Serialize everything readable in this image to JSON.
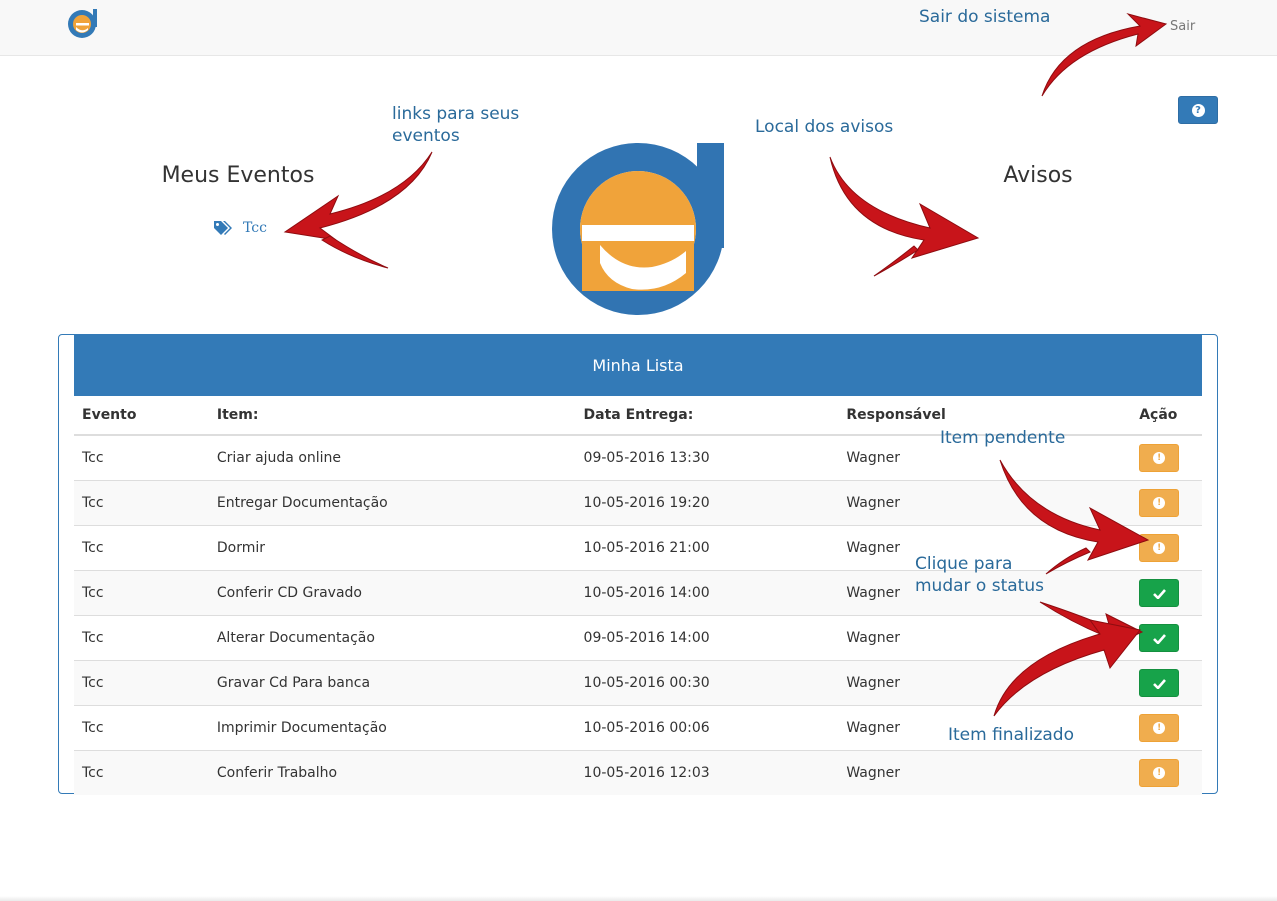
{
  "navbar": {
    "logo_icon": "ed-logo-icon",
    "logout_label": "Sair"
  },
  "help_button": {
    "icon": "question-circle-icon"
  },
  "left_column": {
    "title": "Meus Eventos",
    "events": [
      {
        "icon": "tags-icon",
        "label": "Tcc"
      }
    ]
  },
  "right_column": {
    "title": "Avisos"
  },
  "center_logo": {
    "icon": "ed-logo"
  },
  "panel": {
    "heading": "Minha Lista",
    "columns": [
      "Evento",
      "Item:",
      "Data Entrega:",
      "Responsável",
      "Ação"
    ],
    "rows": [
      {
        "evento": "Tcc",
        "item": "Criar ajuda online",
        "data": "09-05-2016 13:30",
        "responsavel": "Wagner",
        "status": "pendente"
      },
      {
        "evento": "Tcc",
        "item": "Entregar Documentação",
        "data": "10-05-2016 19:20",
        "responsavel": "Wagner",
        "status": "pendente"
      },
      {
        "evento": "Tcc",
        "item": "Dormir",
        "data": "10-05-2016 21:00",
        "responsavel": "Wagner",
        "status": "pendente"
      },
      {
        "evento": "Tcc",
        "item": "Conferir CD Gravado",
        "data": "10-05-2016 14:00",
        "responsavel": "Wagner",
        "status": "finalizado"
      },
      {
        "evento": "Tcc",
        "item": "Alterar Documentação",
        "data": "09-05-2016 14:00",
        "responsavel": "Wagner",
        "status": "finalizado"
      },
      {
        "evento": "Tcc",
        "item": "Gravar Cd Para banca",
        "data": "10-05-2016 00:30",
        "responsavel": "Wagner",
        "status": "finalizado"
      },
      {
        "evento": "Tcc",
        "item": "Imprimir Documentação",
        "data": "10-05-2016 00:06",
        "responsavel": "Wagner",
        "status": "pendente"
      },
      {
        "evento": "Tcc",
        "item": "Conferir Trabalho",
        "data": "10-05-2016 12:03",
        "responsavel": "Wagner",
        "status": "pendente"
      }
    ]
  },
  "annotations": {
    "sair": "Sair do sistema",
    "links": "links para seus\neventos",
    "avisos": "Local dos avisos",
    "pendente": "Item pendente",
    "clique": "Clique para\nmudar o status",
    "finalizado": "Item finalizado"
  },
  "colors": {
    "primary": "#337ab7",
    "pending": "#f0ad4e",
    "done": "#17a34a",
    "annotation_text": "#2a6a9a",
    "arrow": "#c8141a"
  }
}
